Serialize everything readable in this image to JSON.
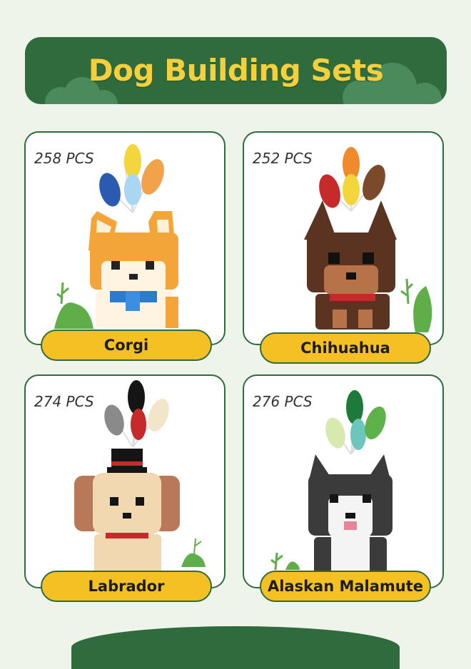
{
  "header": {
    "title": "Dog Building Sets"
  },
  "colors": {
    "banner_green": "#2f6b3c",
    "title_yellow": "#f5cf3c",
    "pill_yellow": "#f5c024",
    "page_bg": "#eef4ea"
  },
  "cards": [
    {
      "pieces": "258 PCS",
      "name": "Corgi",
      "image": "corgi-building-block-figure"
    },
    {
      "pieces": "252 PCS",
      "name": "Chihuahua",
      "image": "chihuahua-building-block-figure"
    },
    {
      "pieces": "274 PCS",
      "name": "Labrador",
      "image": "labrador-building-block-figure"
    },
    {
      "pieces": "276 PCS",
      "name": "Alaskan  Malamute",
      "image": "alaskan-malamute-building-block-figure"
    }
  ]
}
